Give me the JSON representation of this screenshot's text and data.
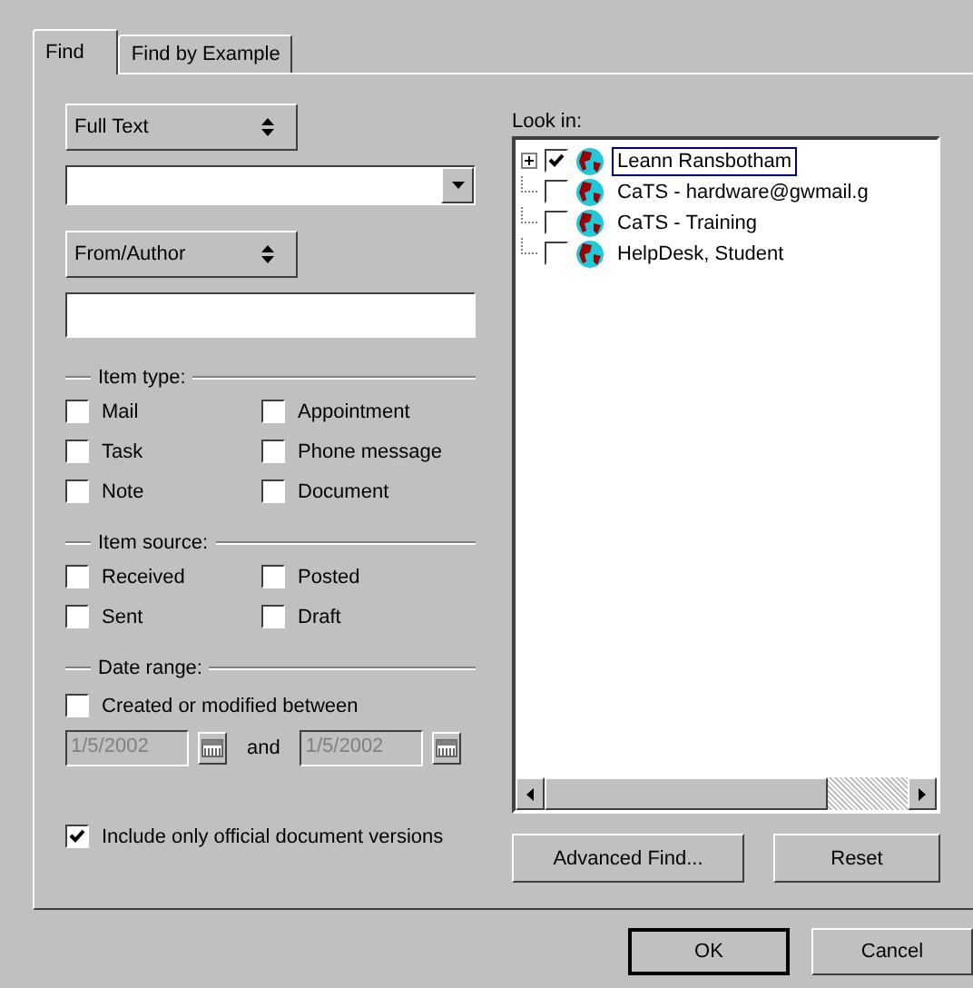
{
  "tabs": [
    {
      "label": "Find",
      "selected": true
    },
    {
      "label": "Find by Example",
      "selected": false
    }
  ],
  "search_type": {
    "value": "Full Text"
  },
  "field_type": {
    "value": "From/Author"
  },
  "item_type": {
    "title": "Item type:",
    "options": [
      {
        "label": "Mail",
        "checked": false
      },
      {
        "label": "Appointment",
        "checked": false
      },
      {
        "label": "Task",
        "checked": false
      },
      {
        "label": "Phone message",
        "checked": false
      },
      {
        "label": "Note",
        "checked": false
      },
      {
        "label": "Document",
        "checked": false
      }
    ]
  },
  "item_source": {
    "title": "Item source:",
    "options": [
      {
        "label": "Received",
        "checked": false
      },
      {
        "label": "Posted",
        "checked": false
      },
      {
        "label": "Sent",
        "checked": false
      },
      {
        "label": "Draft",
        "checked": false
      }
    ]
  },
  "date_range": {
    "title": "Date range:",
    "enable": {
      "label": "Created or modified between",
      "checked": false
    },
    "from": {
      "value": "1/5/2002",
      "disabled": true
    },
    "conjunction": "and",
    "to": {
      "value": "1/5/2002",
      "disabled": true
    }
  },
  "official_versions": {
    "label": "Include only official document versions",
    "checked": true
  },
  "look_in": {
    "label": "Look in:",
    "items": [
      {
        "label": "Leann Ransbotham",
        "kind": "expandable",
        "checked": true,
        "selected": true
      },
      {
        "label": "CaTS - hardware@gwmail.g",
        "kind": "leaf",
        "checked": false,
        "selected": false
      },
      {
        "label": "CaTS - Training",
        "kind": "leaf",
        "checked": false,
        "selected": false
      },
      {
        "label": "HelpDesk, Student",
        "kind": "leaf",
        "checked": false,
        "selected": false
      }
    ]
  },
  "panel_buttons": [
    "Advanced Find...",
    "Reset"
  ],
  "dialog_buttons": [
    {
      "label": "OK",
      "default": true
    },
    {
      "label": "Cancel",
      "default": false
    }
  ]
}
